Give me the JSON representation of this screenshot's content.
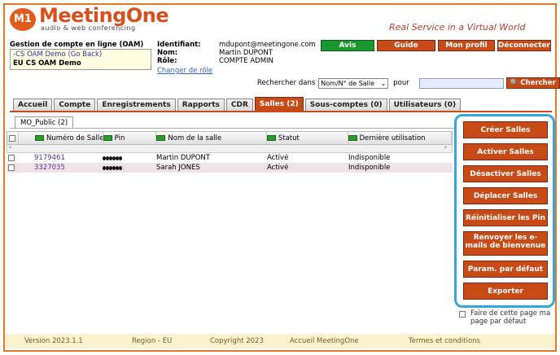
{
  "brand": {
    "logo_mark": "M1",
    "name": "MeetingOne",
    "tag": "audio & web conferencing",
    "tagline": "Real Service in a Virtual World"
  },
  "oam": {
    "title": "Gestion de compte en ligne (OAM)",
    "back_link": "-CS OAM Demo (Go Back)",
    "account": "EU CS OAM Demo"
  },
  "user_info": {
    "id_label": "Identifiant:",
    "id_value": "mdupont@meetingone.com",
    "name_label": "Nom:",
    "name_value": "Martin DUPONT",
    "role_label": "Rôle:",
    "role_value": "COMPTE ADMIN",
    "change_role": "Changer de rôle"
  },
  "top_buttons": {
    "avis": "Avis",
    "guide": "Guide",
    "profil": "Mon profil",
    "deconnecter": "Déconnecter"
  },
  "search": {
    "label": "Rechercher dans",
    "select_value": "Nom/N° de Salle",
    "for_label": "pour",
    "input_value": "",
    "button": "Chercher"
  },
  "tabs": [
    {
      "label": "Accueil"
    },
    {
      "label": "Compte"
    },
    {
      "label": "Enregistrements"
    },
    {
      "label": "Rapports"
    },
    {
      "label": "CDR"
    },
    {
      "label": "Salles (2)"
    },
    {
      "label": "Sous-comptes (0)"
    },
    {
      "label": "Utilisateurs (0)"
    }
  ],
  "subtab": "MO_Public (2)",
  "grid": {
    "headers": [
      "Numéro de Salle",
      "Pin",
      "Nom de la salle",
      "Statut",
      "Dernière utilisation"
    ],
    "rows": [
      {
        "number": "9179461",
        "name": "Martin DUPONT",
        "status": "Activé",
        "last_use": "Indisponible"
      },
      {
        "number": "3327035",
        "name": "Sarah JONES",
        "status": "Activé",
        "last_use": "Indisponible"
      }
    ]
  },
  "side_buttons": {
    "create": "Créer Salles",
    "activate": "Activer Salles",
    "deactivate": "Désactiver Salles",
    "move": "Déplacer Salles",
    "reset_pin": "Réinitialiser les Pin",
    "resend": "Renvoyer les e-mails de bienvenue",
    "defaults": "Param. par défaut",
    "export": "Exporter"
  },
  "default_page": "Faire de cette page ma page par défaut",
  "footer": {
    "version": "Version 2023.1.1",
    "region": "Region - EU",
    "copyright": "Copyright 2023",
    "home": "Accueil MeetingOne",
    "terms": "Termes et conditions"
  },
  "colors": {
    "accent": "#c84a16",
    "avis": "#19962e",
    "highlight": "#33a8e0"
  }
}
